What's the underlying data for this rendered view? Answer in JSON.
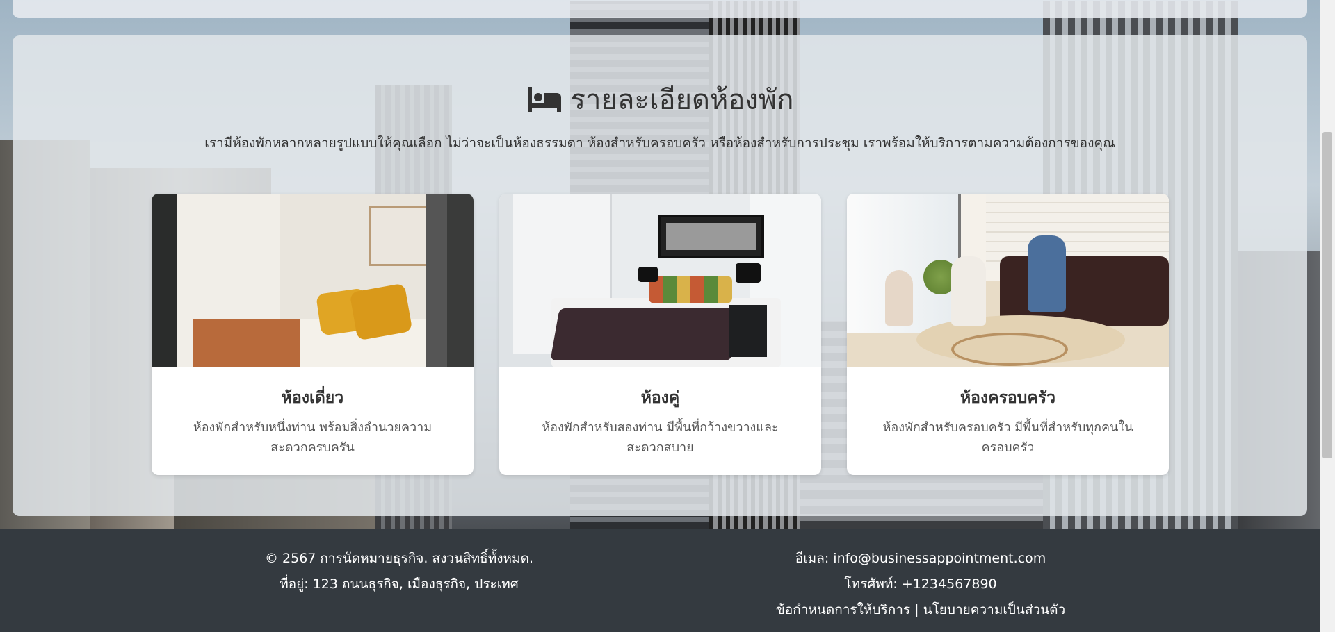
{
  "rooms_section": {
    "title": "รายละเอียดห้องพัก",
    "subtitle": "เรามีห้องพักหลากหลายรูปแบบให้คุณเลือก ไม่ว่าจะเป็นห้องธรรมดา ห้องสำหรับครอบครัว หรือห้องสำหรับการประชุม เราพร้อมให้บริการตามความต้องการของคุณ",
    "cards": [
      {
        "name": "ห้องเดี่ยว",
        "description": "ห้องพักสำหรับหนึ่งท่าน พร้อมสิ่งอำนวยความสะดวกครบครัน"
      },
      {
        "name": "ห้องคู่",
        "description": "ห้องพักสำหรับสองท่าน มีพื้นที่กว้างขวางและสะดวกสบาย"
      },
      {
        "name": "ห้องครอบครัว",
        "description": "ห้องพักสำหรับครอบครัว มีพื้นที่สำหรับทุกคนในครอบครัว"
      }
    ]
  },
  "footer": {
    "copyright": "© 2567 การนัดหมายธุรกิจ. สงวนสิทธิ์ทั้งหมด.",
    "address": "ที่อยู่: 123 ถนนธุรกิจ, เมืองธุรกิจ, ประเทศ",
    "email": "อีเมล: info@businessappointment.com",
    "phone": "โทรศัพท์: +1234567890",
    "terms_link": "ข้อกำหนดการให้บริการ",
    "separator": "|",
    "privacy_link": "นโยบายความเป็นส่วนตัว"
  },
  "icons": {
    "title_icon": "bed-icon"
  },
  "colors": {
    "footer_bg": "#343a40",
    "panel_bg": "#e2e6ea"
  }
}
